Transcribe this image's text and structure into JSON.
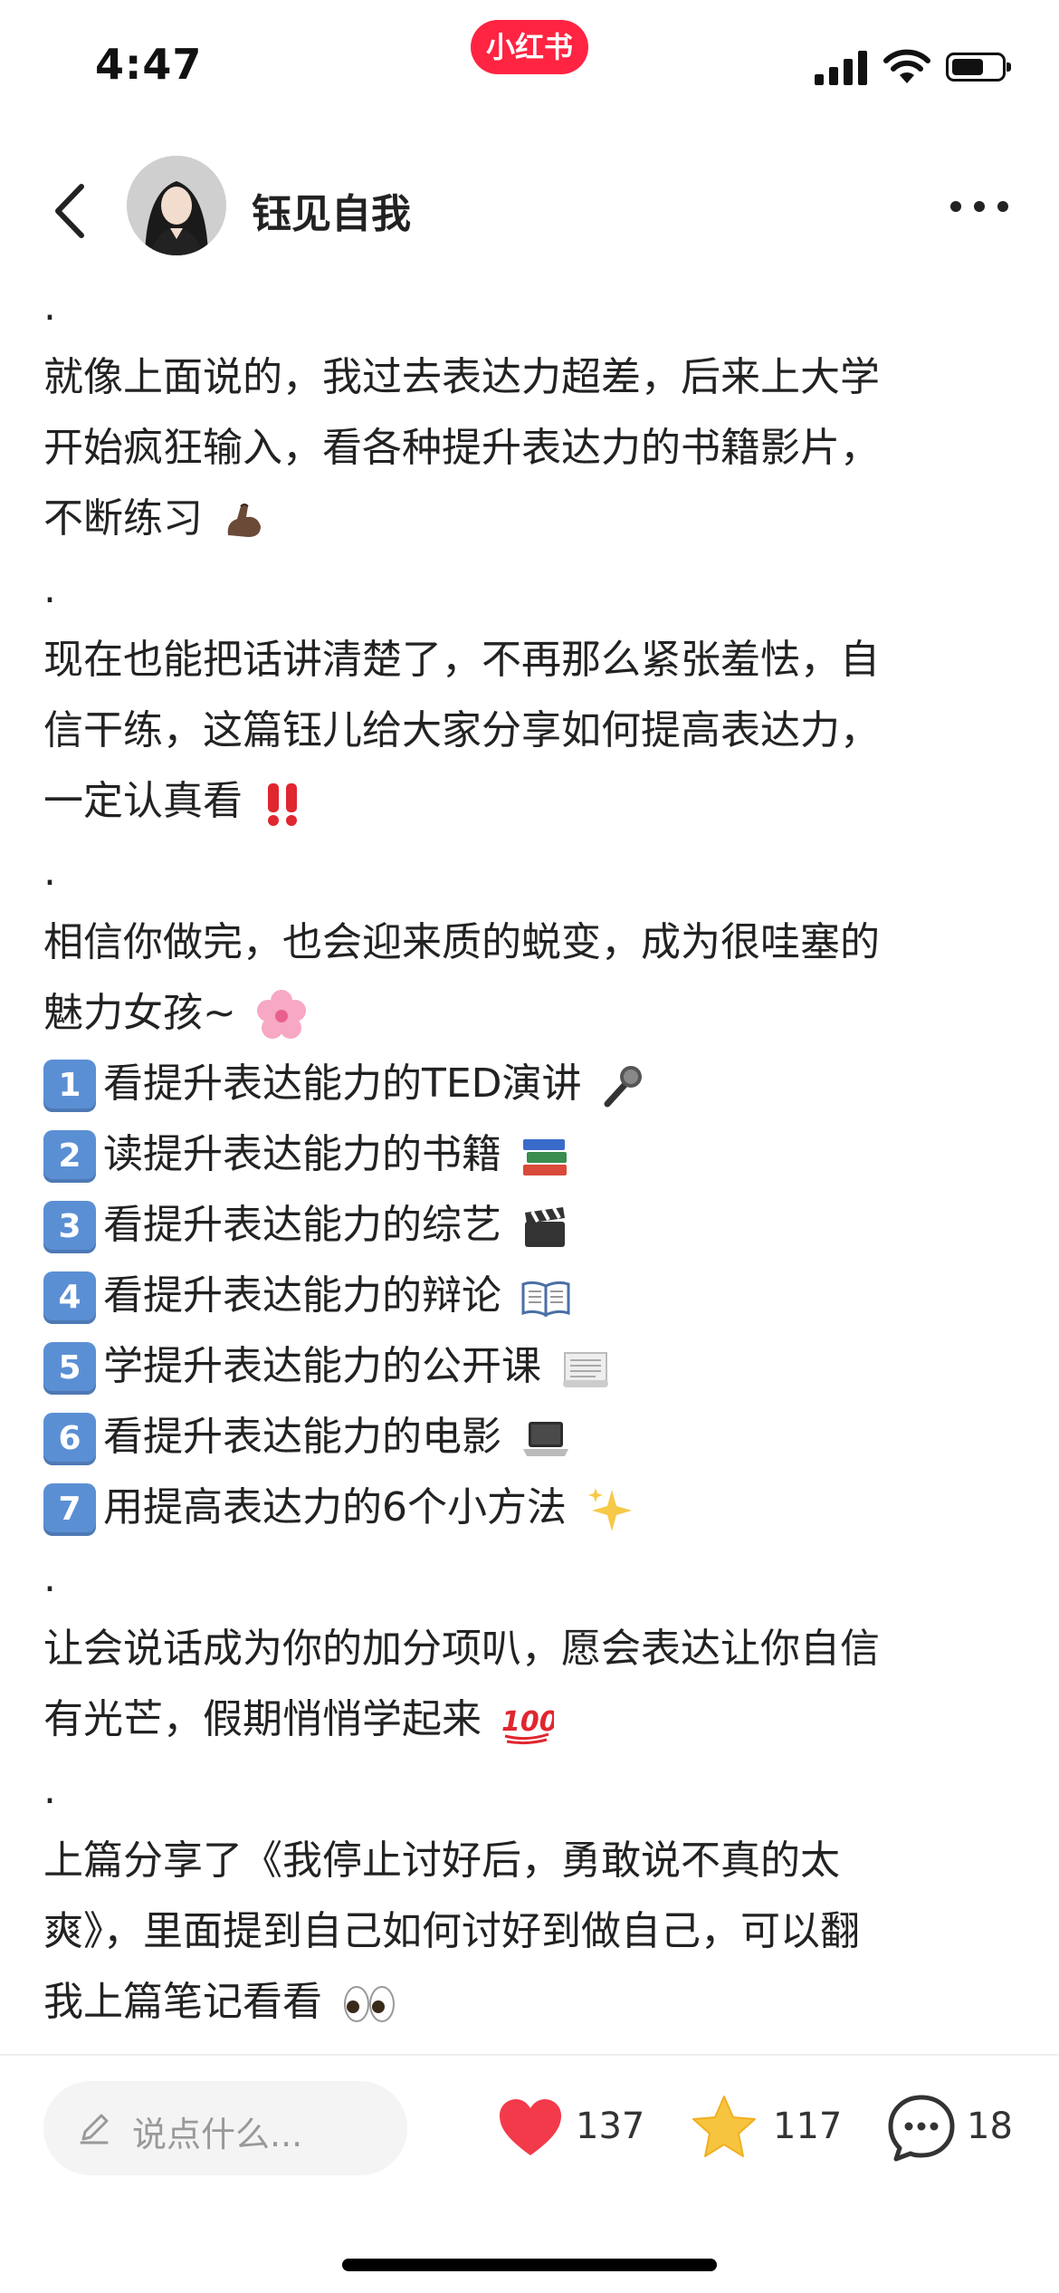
{
  "status_bar": {
    "time": "4:47",
    "app_badge": "小红书"
  },
  "header": {
    "author": "钰见自我"
  },
  "content": {
    "lines": [
      ".",
      "就像上面说的，我过去表达力超差，后来上大学",
      "开始疯狂输入，看各种提升表达力的书籍影片，",
      "不断练习",
      ".",
      "现在也能把话讲清楚了，不再那么紧张羞怯，自",
      "信干练，这篇钰儿给大家分享如何提高表达力，",
      "一定认真看",
      ".",
      "相信你做完，也会迎来质的蜕变，成为很哇塞的",
      "魅力女孩~"
    ],
    "list": [
      {
        "num": "1",
        "text": "看提升表达能力的TED演讲",
        "icon": "microphone-icon"
      },
      {
        "num": "2",
        "text": "读提升表达能力的书籍",
        "icon": "books-icon"
      },
      {
        "num": "3",
        "text": "看提升表达能力的综艺",
        "icon": "clapperboard-icon"
      },
      {
        "num": "4",
        "text": "看提升表达能力的辩论",
        "icon": "open-book-icon"
      },
      {
        "num": "5",
        "text": "学提升表达能力的公开课",
        "icon": "scroll-icon"
      },
      {
        "num": "6",
        "text": "看提升表达能力的电影",
        "icon": "laptop-icon"
      },
      {
        "num": "7",
        "text": "用提高表达力的6个小方法",
        "icon": "sparkles-icon"
      }
    ],
    "lines2": [
      ".",
      "让会说话成为你的加分项叭，愿会表达让你自信",
      "有光芒，假期悄悄学起来",
      ".",
      "上篇分享了《我停止讨好后，勇敢说不真的太",
      "爽》，里面提到自己如何讨好到做自己，可以翻",
      "我上篇笔记看看"
    ]
  },
  "bottom_bar": {
    "comment_placeholder": "说点什么...",
    "likes": "137",
    "favorites": "117",
    "comments": "18"
  },
  "colors": {
    "brand": "#ff2442",
    "like": "#ff2442",
    "star": "#f7b731",
    "keycap": "#5b8fd4"
  }
}
